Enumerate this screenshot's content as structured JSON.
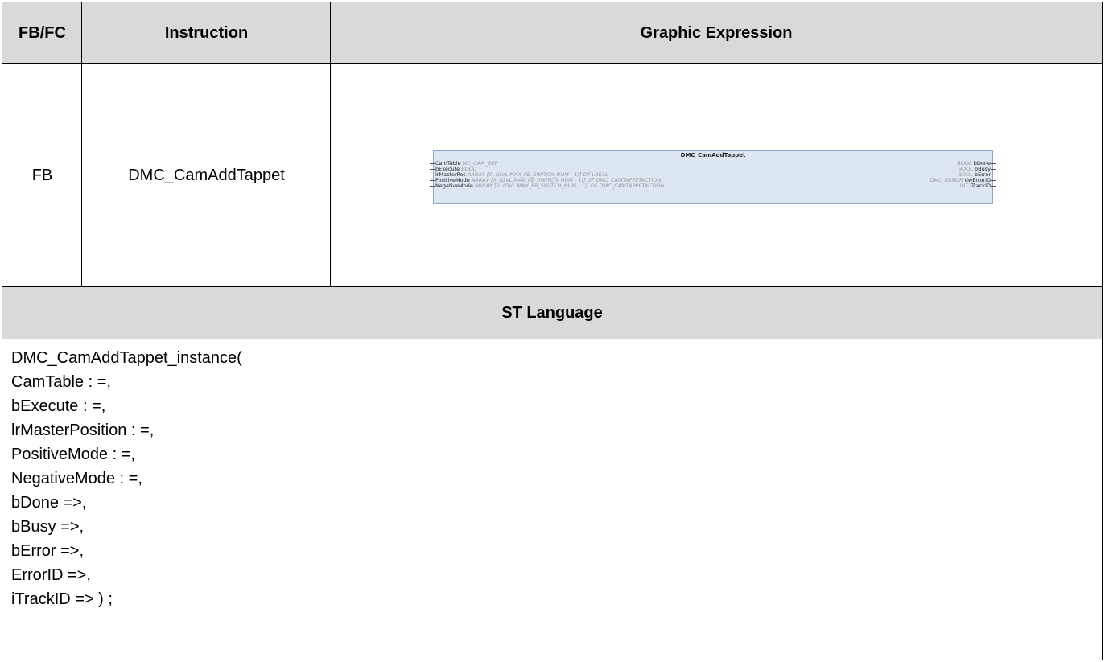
{
  "header": {
    "col1": "FB/FC",
    "col2": "Instruction",
    "col3": "Graphic Expression"
  },
  "row": {
    "type": "FB",
    "instruction": "DMC_CamAddTappet"
  },
  "block": {
    "title": "DMC_CamAddTappet",
    "inputs": [
      {
        "name": "CamTable",
        "type": "MC_CAM_REF"
      },
      {
        "name": "bExecute",
        "type": "BOOL"
      },
      {
        "name": "lrMasterPos",
        "type": "ARRAY [0..(GVL.MAX_FB_SWITCH_NUM - 1)] OF LREAL"
      },
      {
        "name": "PositiveMode",
        "type": "ARRAY [0..(GVL.MAX_FB_SWITCH_NUM - 1)] OF DMC_CAMTAPPETACTION"
      },
      {
        "name": "NegativeMode",
        "type": "ARRAY [0..(GVL.MAX_FB_SWITCH_NUM - 1)] OF DMC_CAMTAPPETACTION"
      }
    ],
    "outputs": [
      {
        "name": "bDone",
        "type": "BOOL"
      },
      {
        "name": "bBusy",
        "type": "BOOL"
      },
      {
        "name": "bError",
        "type": "BOOL"
      },
      {
        "name": "dwErrorID",
        "type": "DMC_ERROR"
      },
      {
        "name": "iTrackID",
        "type": "INT"
      }
    ]
  },
  "st_header": "ST Language",
  "st_code": [
    "DMC_CamAddTappet_instance(",
    "CamTable : =,",
    "bExecute : =,",
    "lrMasterPosition : =,",
    "PositiveMode : =,",
    "NegativeMode : =,",
    "bDone =>,",
    "bBusy =>,",
    "bError =>,",
    "ErrorID =>,",
    "iTrackID => ) ;"
  ]
}
